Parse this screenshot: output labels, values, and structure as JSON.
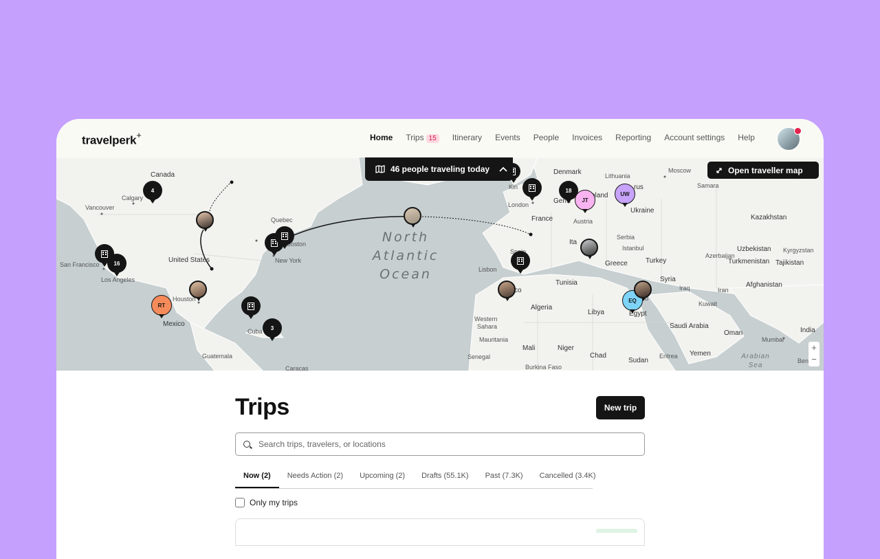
{
  "brand": {
    "name": "travelperk",
    "mark": "+"
  },
  "nav": {
    "items": [
      {
        "label": "Home",
        "active": true
      },
      {
        "label": "Trips",
        "badge": "15"
      },
      {
        "label": "Itinerary"
      },
      {
        "label": "Events"
      },
      {
        "label": "People"
      },
      {
        "label": "Invoices"
      },
      {
        "label": "Reporting"
      },
      {
        "label": "Account settings"
      },
      {
        "label": "Help"
      }
    ]
  },
  "map": {
    "traveling_pill": "46 people traveling today",
    "open_map": "Open traveller map",
    "ocean": [
      "North",
      "Atlantic",
      "Ocean"
    ],
    "arabian_sea": [
      "Arabian",
      "Sea"
    ],
    "zoom_in": "+",
    "zoom_out": "−",
    "places": [
      "Canada",
      "Calgary",
      "Vancouver",
      "Quebec",
      "Boston",
      "New York",
      "San Francisco",
      "Los Angeles",
      "United States",
      "Houston",
      "Mexico",
      "Cuba",
      "Guatemala",
      "Caracas",
      "Denmark",
      "Lithuania",
      "Moscow",
      "Kin",
      "London",
      "Germ",
      "oland",
      "rus",
      "Samara",
      "Ukraine",
      "Kazakhstan",
      "France",
      "Ita",
      "Austria",
      "Serbia",
      "Istanbul",
      "Greece",
      "Turkey",
      "Uzbekistan",
      "Kyrgyzstan",
      "Azerbaijan",
      "Turkmenistan",
      "Tajikistan",
      "Spain",
      "Lisbon",
      "cco",
      "Tunisia",
      "Syria",
      "Iraq",
      "Iran",
      "Afghanistan",
      "Kuwait",
      "Algeria",
      "Libya",
      "airo",
      "Egypt",
      "Western",
      "Sahara",
      "Mauritania",
      "Mali",
      "Niger",
      "Chad",
      "Saudi Arabia",
      "Oman",
      "Mumbai",
      "India",
      "Senegal",
      "Burkina Faso",
      "Sudan",
      "Eritrea",
      "Yemen",
      "Benga"
    ],
    "clusters": [
      "4",
      "16",
      "18",
      "3"
    ],
    "initials": [
      "JT",
      "UW",
      "RT",
      "EQ"
    ],
    "colors": {
      "jt": "#f8b4f0",
      "uw": "#c7a3fb",
      "rt": "#f58b5b",
      "eq": "#7ed4f6"
    }
  },
  "trips": {
    "title": "Trips",
    "new_trip": "New trip",
    "search_placeholder": "Search trips, travelers, or locations",
    "tabs": [
      "Now (2)",
      "Needs Action (2)",
      "Upcoming (2)",
      "Drafts (55.1K)",
      "Past (7.3K)",
      "Cancelled (3.4K)"
    ],
    "only_my_trips": "Only my trips"
  }
}
